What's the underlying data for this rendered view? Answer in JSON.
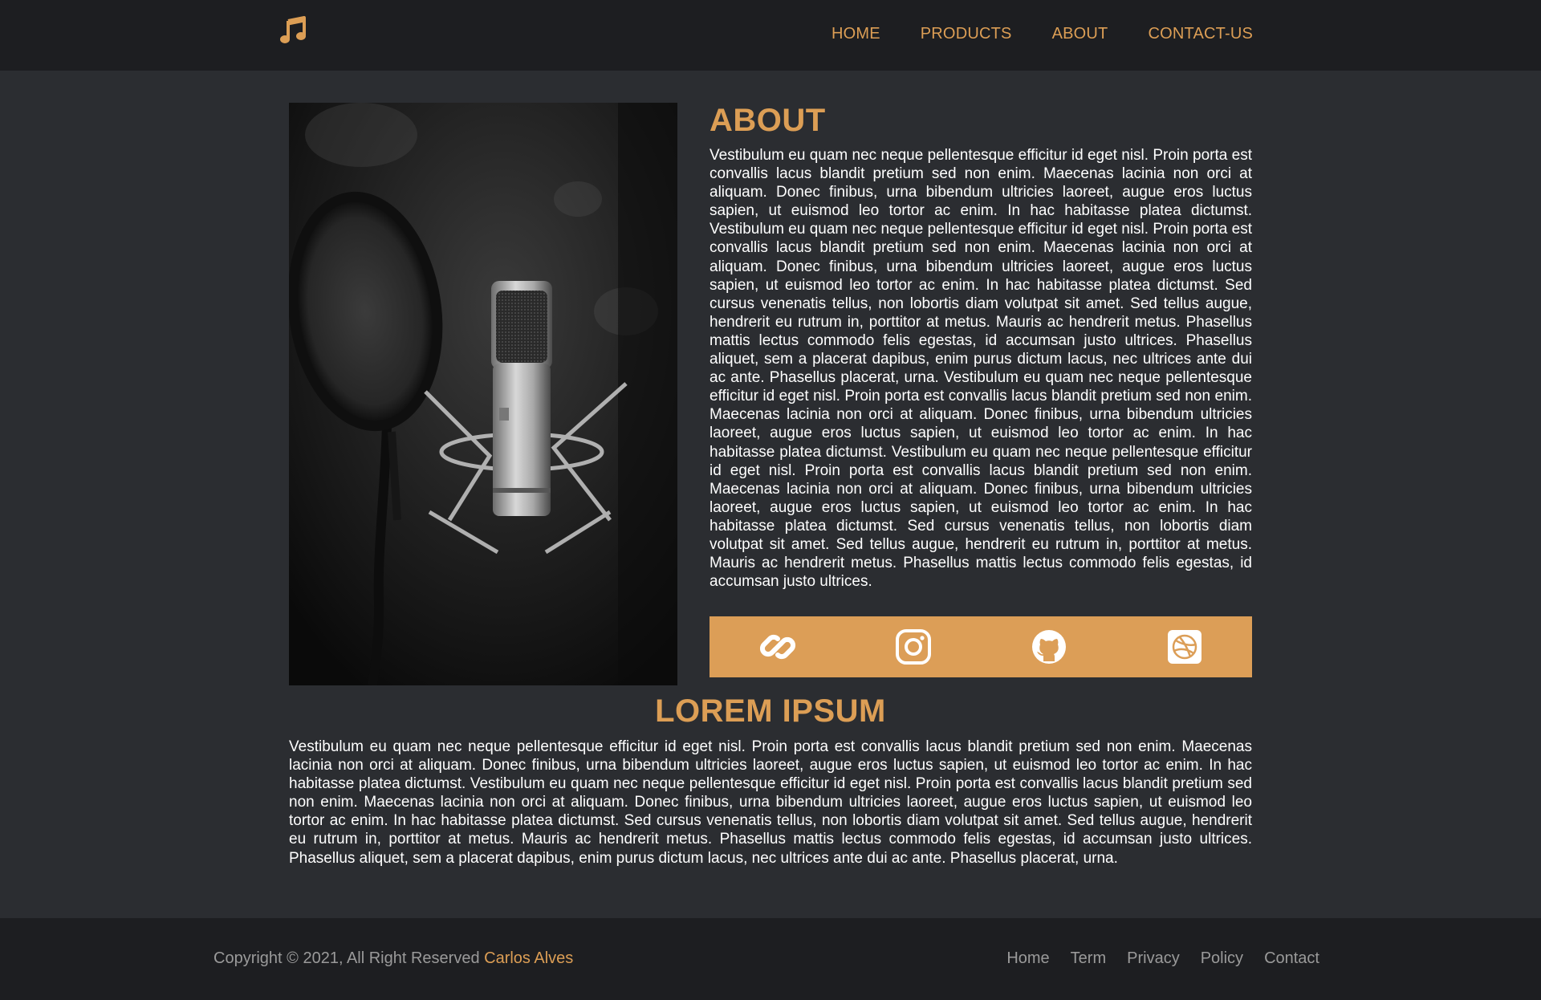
{
  "header": {
    "logo_icon": "music-note-icon",
    "nav": [
      "HOME",
      "PRODUCTS",
      "ABOUT",
      "CONTACT-US"
    ]
  },
  "about": {
    "image_alt": "studio-microphone-with-pop-filter",
    "title": "ABOUT",
    "text": "Vestibulum eu quam nec neque pellentesque efficitur id eget nisl. Proin porta est convallis lacus blandit pretium sed non enim. Maecenas lacinia non orci at aliquam. Donec finibus, urna bibendum ultricies laoreet, augue eros luctus sapien, ut euismod leo tortor ac enim. In hac habitasse platea dictumst. Vestibulum eu quam nec neque pellentesque efficitur id eget nisl. Proin porta est convallis lacus blandit pretium sed non enim. Maecenas lacinia non orci at aliquam. Donec finibus, urna bibendum ultricies laoreet, augue eros luctus sapien, ut euismod leo tortor ac enim. In hac habitasse platea dictumst. Sed cursus venenatis tellus, non lobortis diam volutpat sit amet. Sed tellus augue, hendrerit eu rutrum in, porttitor at metus. Mauris ac hendrerit metus. Phasellus mattis lectus commodo felis egestas, id accumsan justo ultrices. Phasellus aliquet, sem a placerat dapibus, enim purus dictum lacus, nec ultrices ante dui ac ante. Phasellus placerat, urna. Vestibulum eu quam nec neque pellentesque efficitur id eget nisl. Proin porta est convallis lacus blandit pretium sed non enim. Maecenas lacinia non orci at aliquam. Donec finibus, urna bibendum ultricies laoreet, augue eros luctus sapien, ut euismod leo tortor ac enim. In hac habitasse platea dictumst. Vestibulum eu quam nec neque pellentesque efficitur id eget nisl. Proin porta est convallis lacus blandit pretium sed non enim. Maecenas lacinia non orci at aliquam. Donec finibus, urna bibendum ultricies laoreet, augue eros luctus sapien, ut euismod leo tortor ac enim. In hac habitasse platea dictumst. Sed cursus venenatis tellus, non lobortis diam volutpat sit amet. Sed tellus augue, hendrerit eu rutrum in, porttitor at metus. Mauris ac hendrerit metus. Phasellus mattis lectus commodo felis egestas, id accumsan justo ultrices."
  },
  "social": [
    "link-icon",
    "instagram-icon",
    "github-icon",
    "dribbble-icon"
  ],
  "lorem": {
    "title": "LOREM IPSUM",
    "text": "Vestibulum eu quam nec neque pellentesque efficitur id eget nisl. Proin porta est convallis lacus blandit pretium sed non enim. Maecenas lacinia non orci at aliquam. Donec finibus, urna bibendum ultricies laoreet, augue eros luctus sapien, ut euismod leo tortor ac enim. In hac habitasse platea dictumst. Vestibulum eu quam nec neque pellentesque efficitur id eget nisl. Proin porta est convallis lacus blandit pretium sed non enim. Maecenas lacinia non orci at aliquam. Donec finibus, urna bibendum ultricies laoreet, augue eros luctus sapien, ut euismod leo tortor ac enim. In hac habitasse platea dictumst. Sed cursus venenatis tellus, non lobortis diam volutpat sit amet. Sed tellus augue, hendrerit eu rutrum in, porttitor at metus. Mauris ac hendrerit metus. Phasellus mattis lectus commodo felis egestas, id accumsan justo ultrices. Phasellus aliquet, sem a placerat dapibus, enim purus dictum lacus, nec ultrices ante dui ac ante. Phasellus placerat, urna."
  },
  "footer": {
    "copyright": "Copyright © 2021, All Right Reserved",
    "author": "Carlos Alves",
    "links": [
      "Home",
      "Term",
      "Privacy",
      "Policy",
      "Contact"
    ]
  },
  "colors": {
    "accent": "#dc9e55",
    "header_bg": "#1d1e21",
    "page_bg": "#2b2d31",
    "footer_text": "#9a9a9a"
  }
}
